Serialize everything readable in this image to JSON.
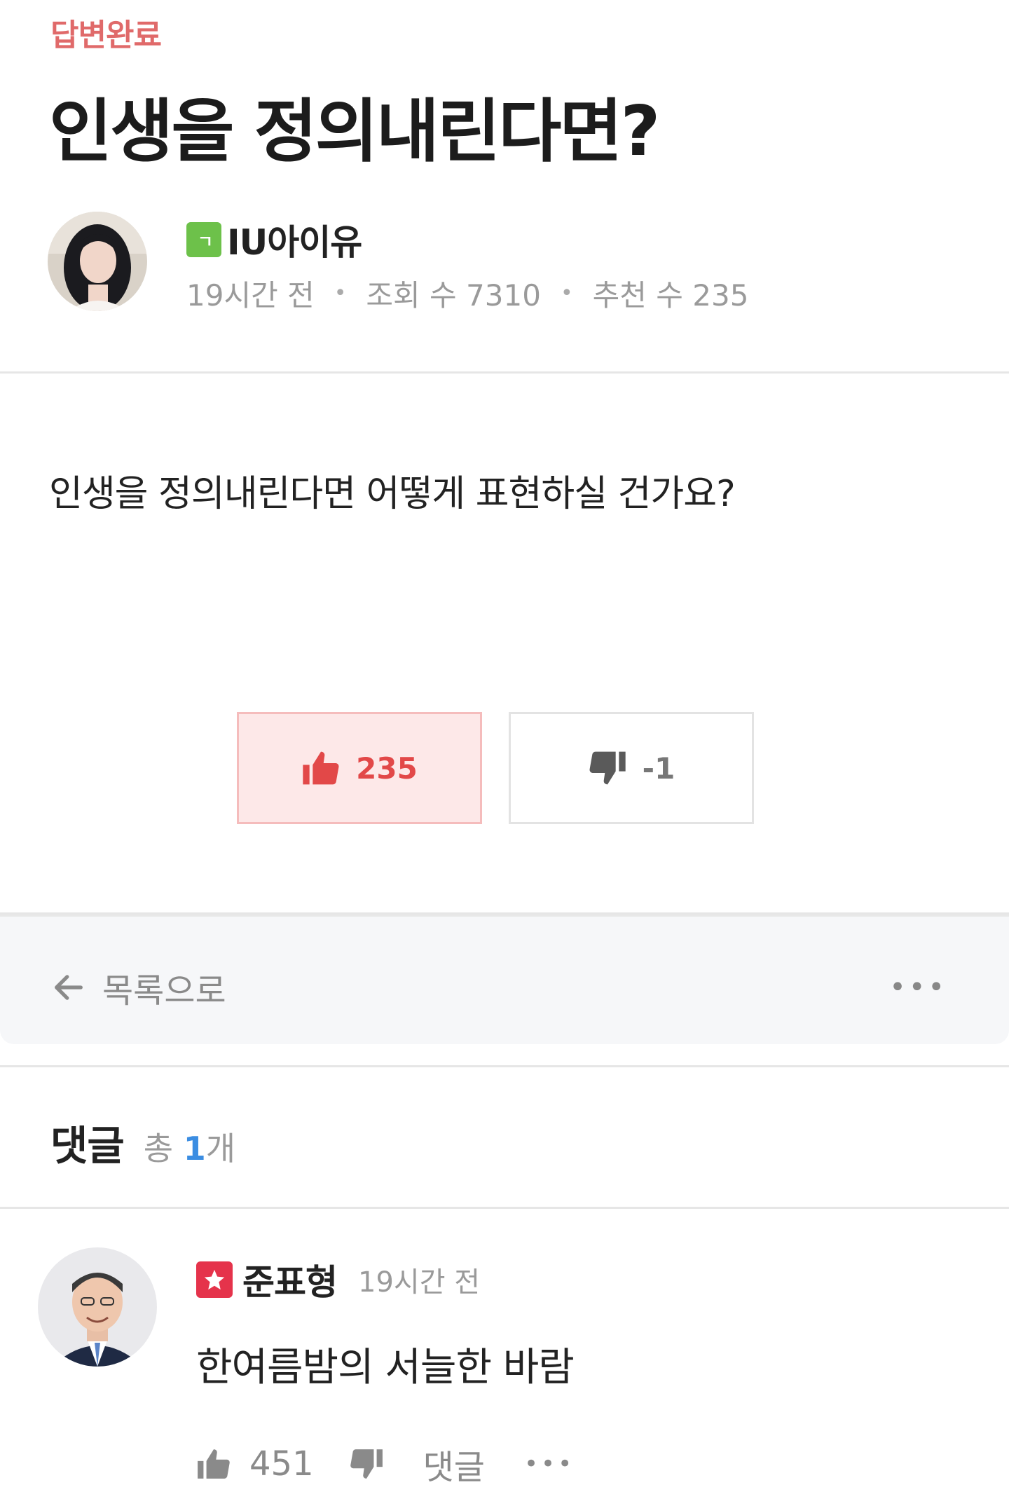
{
  "post": {
    "status": "답변완료",
    "title": "인생을 정의내린다면?",
    "author": "IU아이유",
    "level_badge": "ㄱ",
    "time": "19시간 전",
    "views": "조회 수 7310",
    "recommends": "추천 수 235",
    "body": "인생을 정의내린다면 어떻게 표현하실 건가요?",
    "upvotes": "235",
    "downvotes": "-1"
  },
  "nav": {
    "back_label": "목록으로",
    "more": "•••"
  },
  "comments": {
    "title": "댓글",
    "count_prefix": "총",
    "count": "1",
    "count_suffix": "개",
    "items": [
      {
        "user": "준표형",
        "time": "19시간 전",
        "text": "한여름밤의 서늘한 바람",
        "likes": "451",
        "reply_label": "댓글",
        "more": "•••"
      }
    ]
  },
  "colors": {
    "status": "#e06a6a",
    "upvote": "#e24848",
    "count_accent": "#3b8de2",
    "level_badge": "#6dc14a",
    "star_badge": "#e5334b"
  },
  "icons": [
    "thumbs-up-icon",
    "thumbs-down-icon",
    "arrow-left-icon",
    "more-icon",
    "star-icon"
  ]
}
